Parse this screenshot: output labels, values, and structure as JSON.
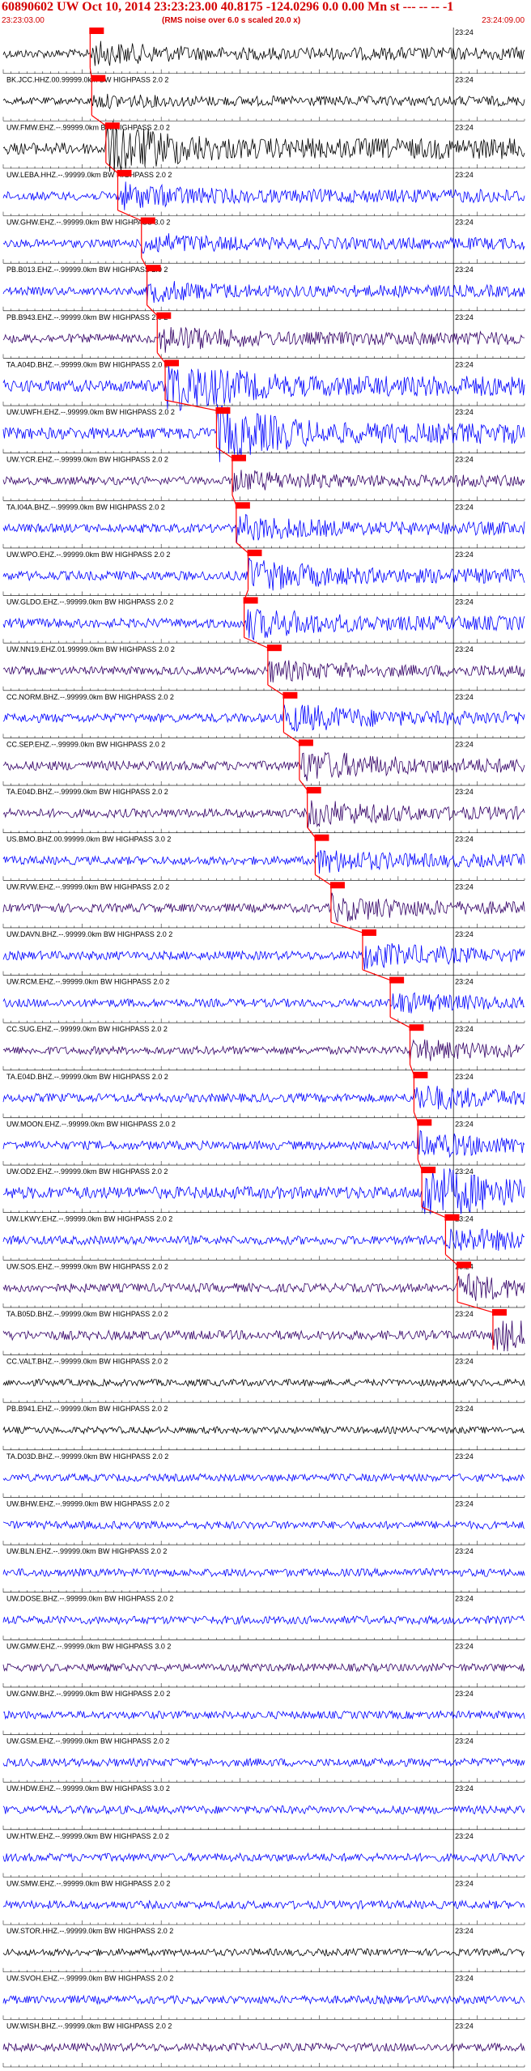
{
  "header": {
    "title": "60890602 UW Oct 10, 2014 23:23:23.00   40.8175 -124.0296  0.0 0.00 Mn st --- -- --  -1",
    "start_time": "23:23:03.00",
    "note": "(RMS noise over 6.0 s scaled 20.0 x)",
    "end_time": "23:24:09.00"
  },
  "chart_data": {
    "type": "line",
    "title": "60890602 UW Oct 10, 2014 23:23:23.00   40.8175 -124.0296  0.0 0.00 Mn st --- -- --  -1",
    "subtitle": "(RMS noise over 6.0 s scaled 20.0 x)",
    "x_range_seconds": [
      0,
      66
    ],
    "x_start_label": "23:23:03.00",
    "x_end_label": "23:24:09.00",
    "minute_marker_label": "23:24",
    "minute_marker_offset_s": 57,
    "colors": {
      "blue": "#0000ff",
      "purple": "#330066",
      "black": "#000000",
      "pick": "#ff0000"
    },
    "traces": [
      {
        "label": "",
        "pick_s": 11.0,
        "color": "black",
        "amp": 0.35
      },
      {
        "label": "BK.JCC.HHZ.00.99999.0km BW  HIGHPASS  2.0  2",
        "pick_s": 11.2,
        "color": "black",
        "amp": 0.15
      },
      {
        "label": "UW.FMW.EHZ.--.99999.0km BW  HIGHPASS  2.0  2",
        "pick_s": 13.0,
        "color": "black",
        "amp": 0.9
      },
      {
        "label": "UW.LEBA.HHZ.--.99999.0km BW  HIGHPASS  2.0  2",
        "pick_s": 14.5,
        "color": "blue",
        "amp": 0.4
      },
      {
        "label": "UW.GHW.EHZ.--.99999.0km BW  HIGHPASS  3.0  2",
        "pick_s": 17.5,
        "color": "blue",
        "amp": 0.3
      },
      {
        "label": "PB.B013.EHZ.--.99999.0km BW  HIGHPASS  2.0  2",
        "pick_s": 18.2,
        "color": "blue",
        "amp": 0.3
      },
      {
        "label": "PB.B943.EHZ.--.99999.0km BW  HIGHPASS  2.0  2",
        "pick_s": 19.5,
        "color": "purple",
        "amp": 0.4
      },
      {
        "label": "TA.A04D.BHZ.--.99999.0km BW  HIGHPASS  2.0  2",
        "pick_s": 20.5,
        "color": "blue",
        "amp": 0.9
      },
      {
        "label": "UW.UWFH.EHZ.--.99999.0km BW  HIGHPASS  2.0  2",
        "pick_s": 27.0,
        "color": "blue",
        "amp": 0.9
      },
      {
        "label": "UW.YCR.EHZ.--.99999.0km BW  HIGHPASS  2.0  2",
        "pick_s": 29.0,
        "color": "purple",
        "amp": 0.3
      },
      {
        "label": "TA.I04A.BHZ.--.99999.0km BW  HIGHPASS  2.0  2",
        "pick_s": 29.5,
        "color": "blue",
        "amp": 0.4
      },
      {
        "label": "UW.WPO.EHZ.--.99999.0km BW  HIGHPASS  2.0  2",
        "pick_s": 31.0,
        "color": "blue",
        "amp": 0.5
      },
      {
        "label": "UW.GLDO.EHZ.--.99999.0km BW  HIGHPASS  2.0  2",
        "pick_s": 30.5,
        "color": "blue",
        "amp": 0.5
      },
      {
        "label": "UW.NN19.EHZ.01.99999.0km BW  HIGHPASS  2.0  2",
        "pick_s": 33.5,
        "color": "purple",
        "amp": 0.3
      },
      {
        "label": "CC.NORM.BHZ.--.99999.0km BW  HIGHPASS  2.0  2",
        "pick_s": 35.5,
        "color": "blue",
        "amp": 0.45
      },
      {
        "label": "CC.SEP.EHZ.--.99999.0km BW  HIGHPASS  2.0  2",
        "pick_s": 37.5,
        "color": "purple",
        "amp": 0.5
      },
      {
        "label": "TA.E04D.BHZ.--.99999.0km BW  HIGHPASS  2.0  2",
        "pick_s": 38.5,
        "color": "purple",
        "amp": 0.4
      },
      {
        "label": "US.BMO.BHZ.00.99999.0km BW  HIGHPASS  3.0  2",
        "pick_s": 39.5,
        "color": "blue",
        "amp": 0.35
      },
      {
        "label": "UW.RVW.EHZ.--.99999.0km BW  HIGHPASS  2.0  2",
        "pick_s": 41.5,
        "color": "purple",
        "amp": 0.4
      },
      {
        "label": "UW.DAVN.BHZ.--.99999.0km BW  HIGHPASS  2.0  2",
        "pick_s": 45.5,
        "color": "blue",
        "amp": 0.4
      },
      {
        "label": "UW.RCM.EHZ.--.99999.0km BW  HIGHPASS  2.0  2",
        "pick_s": 49.0,
        "color": "blue",
        "amp": 0.3
      },
      {
        "label": "CC.SUG.EHZ.--.99999.0km BW  HIGHPASS  2.0  2",
        "pick_s": 51.5,
        "color": "purple",
        "amp": 0.3
      },
      {
        "label": "TA.E04D.BHZ.--.99999.0km BW  HIGHPASS  2.0  2",
        "pick_s": 52.0,
        "color": "blue",
        "amp": 0.4
      },
      {
        "label": "UW.MOON.EHZ.--.99999.0km BW  HIGHPASS  2.0  2",
        "pick_s": 52.5,
        "color": "blue",
        "amp": 0.4
      },
      {
        "label": "UW.OD2.EHZ.--.99999.0km BW  HIGHPASS  2.0  2",
        "pick_s": 53.0,
        "color": "blue",
        "amp": 0.95
      },
      {
        "label": "UW.LKWY.EHZ.--.99999.0km BW  HIGHPASS  2.0  2",
        "pick_s": 56.0,
        "color": "blue",
        "amp": 0.4
      },
      {
        "label": "UW.SOS.EHZ.--.99999.0km BW  HIGHPASS  2.0  2",
        "pick_s": 57.5,
        "color": "purple",
        "amp": 0.4
      },
      {
        "label": "TA.B05D.BHZ.--.99999.0km BW  HIGHPASS  2.0  2",
        "pick_s": 62.0,
        "color": "purple",
        "amp": 0.5
      },
      {
        "label": "CC.VALT.BHZ.--.99999.0km BW  HIGHPASS  2.0  2",
        "pick_s": null,
        "color": "black",
        "amp": 0.1
      },
      {
        "label": "PB.B941.EHZ.--.99999.0km BW  HIGHPASS  2.0  2",
        "pick_s": null,
        "color": "black",
        "amp": 0.1
      },
      {
        "label": "TA.D03D.BHZ.--.99999.0km BW  HIGHPASS  2.0  2",
        "pick_s": null,
        "color": "blue",
        "amp": 0.2
      },
      {
        "label": "UW.BHW.EHZ.--.99999.0km BW  HIGHPASS  2.0  2",
        "pick_s": null,
        "color": "blue",
        "amp": 0.25
      },
      {
        "label": "UW.BLN.EHZ.--.99999.0km BW  HIGHPASS  2.0  2",
        "pick_s": null,
        "color": "blue",
        "amp": 0.25
      },
      {
        "label": "UW.DOSE.BHZ.--.99999.0km BW  HIGHPASS  2.0  2",
        "pick_s": null,
        "color": "blue",
        "amp": 0.3
      },
      {
        "label": "UW.GMW.EHZ.--.99999.0km BW  HIGHPASS  3.0  2",
        "pick_s": null,
        "color": "purple",
        "amp": 0.25
      },
      {
        "label": "UW.GNW.BHZ.--.99999.0km BW  HIGHPASS  2.0  2",
        "pick_s": null,
        "color": "blue",
        "amp": 0.25
      },
      {
        "label": "UW.GSM.EHZ.--.99999.0km BW  HIGHPASS  2.0  2",
        "pick_s": null,
        "color": "blue",
        "amp": 0.3
      },
      {
        "label": "UW.HDW.EHZ.--.99999.0km BW  HIGHPASS  3.0  2",
        "pick_s": null,
        "color": "blue",
        "amp": 0.3
      },
      {
        "label": "UW.HTW.EHZ.--.99999.0km BW  HIGHPASS  2.0  2",
        "pick_s": null,
        "color": "blue",
        "amp": 0.3
      },
      {
        "label": "UW.SMW.EHZ.--.99999.0km BW  HIGHPASS  2.0  2",
        "pick_s": null,
        "color": "blue",
        "amp": 0.3
      },
      {
        "label": "UW.STOR.HHZ.--.99999.0km BW  HIGHPASS  2.0  2",
        "pick_s": null,
        "color": "black",
        "amp": 0.12
      },
      {
        "label": "UW.SVOH.EHZ.--.99999.0km BW  HIGHPASS  2.0  2",
        "pick_s": null,
        "color": "blue",
        "amp": 0.3
      },
      {
        "label": "UW.WISH.BHZ.--.99999.0km BW  HIGHPASS  2.0  2",
        "pick_s": null,
        "color": "purple",
        "amp": 0.3
      }
    ]
  }
}
